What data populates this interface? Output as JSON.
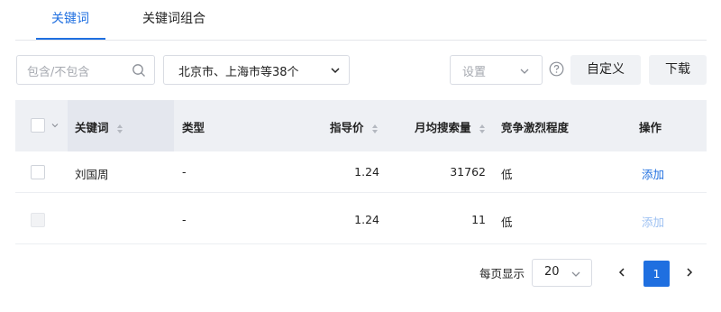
{
  "tabs": [
    {
      "label": "关键词",
      "active": true
    },
    {
      "label": "关键词组合",
      "active": false
    }
  ],
  "filters": {
    "search_placeholder": "包含/不包含",
    "region_value": "北京市、上海市等38个",
    "settings_placeholder": "设置",
    "custom_button": "自定义",
    "download_button": "下载"
  },
  "table": {
    "headers": {
      "keyword": "关键词",
      "type": "类型",
      "guide_price": "指导价",
      "monthly_search": "月均搜索量",
      "competition": "竞争激烈程度",
      "action": "操作"
    },
    "rows": [
      {
        "keyword": "刘国周",
        "type": "-",
        "guide_price": "1.24",
        "monthly_search": "31762",
        "competition": "低",
        "action": "添加",
        "disabled": false
      },
      {
        "keyword": "",
        "type": "-",
        "guide_price": "1.24",
        "monthly_search": "11",
        "competition": "低",
        "action": "添加",
        "disabled": true
      }
    ]
  },
  "pagination": {
    "per_page_label": "每页显示",
    "page_size": "20",
    "current_page": "1"
  },
  "colors": {
    "accent": "#1f6fe0",
    "header_bg": "#eef0f4",
    "border": "#e4e6eb"
  }
}
